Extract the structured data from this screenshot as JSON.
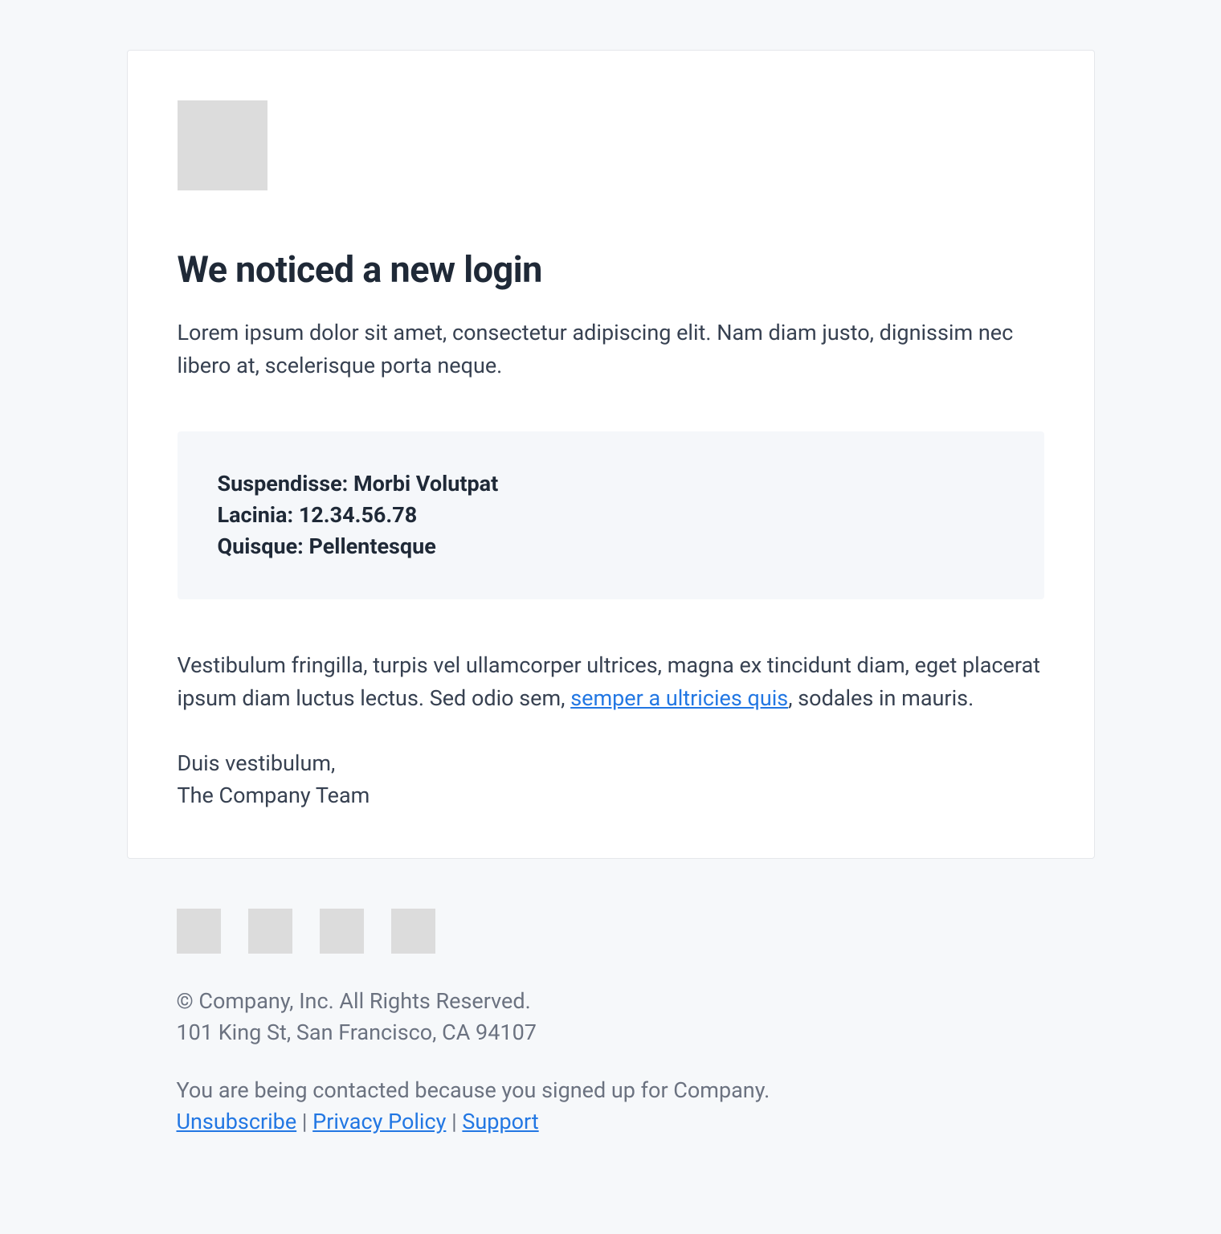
{
  "email": {
    "title": "We noticed a new login",
    "intro": "Lorem ipsum dolor sit amet, consectetur adipiscing elit. Nam diam justo, dignissim nec libero at, scelerisque porta neque.",
    "details": {
      "line1": "Suspendisse: Morbi Volutpat",
      "line2": "Lacinia: 12.34.56.78",
      "line3": "Quisque: Pellentesque"
    },
    "paragraph_before_link": "Vestibulum fringilla, turpis vel ullamcorper ultrices, magna ex tincidunt diam, eget placerat ipsum diam luctus lectus. Sed odio sem, ",
    "inline_link_text": "semper a ultricies quis",
    "paragraph_after_link": ", sodales in mauris.",
    "signoff_line1": "Duis vestibulum,",
    "signoff_line2": "The Company Team"
  },
  "footer": {
    "copyright": "© Company, Inc. All Rights Reserved.",
    "address": "101 King St, San Francisco, CA 94107",
    "contact_reason": "You are being contacted because you signed up for Company.",
    "links": {
      "unsubscribe": "Unsubscribe",
      "privacy": "Privacy Policy",
      "support": "Support"
    },
    "separator": " | "
  }
}
